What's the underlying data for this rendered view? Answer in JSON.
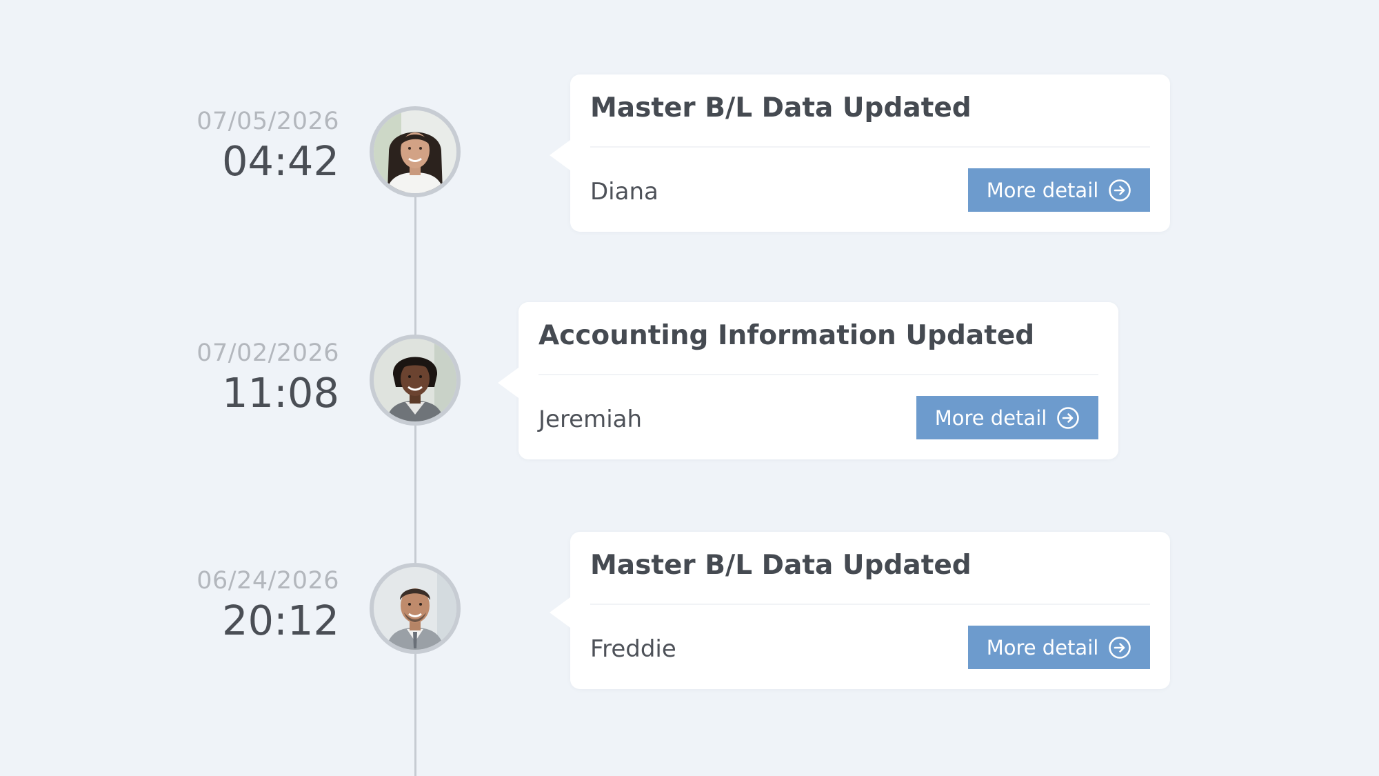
{
  "colors": {
    "background": "#eff3f8",
    "card": "#ffffff",
    "accent_button": "#6d9bcd",
    "timeline_line": "#c6cbd2",
    "date_text": "#b3b7bd",
    "time_text": "#4a4e55",
    "title_text": "#454a51"
  },
  "entries": [
    {
      "date": "07/05/2026",
      "time": "04:42",
      "title": "Master B/L Data Updated",
      "user": "Diana",
      "button_label": "More detail",
      "button_icon": "arrow-right-circle-icon",
      "avatar": "woman-portrait-avatar"
    },
    {
      "date": "07/02/2026",
      "time": "11:08",
      "title": "Accounting Information Updated",
      "user": "Jeremiah",
      "button_label": "More detail",
      "button_icon": "arrow-right-circle-icon",
      "avatar": "woman-portrait-avatar"
    },
    {
      "date": "06/24/2026",
      "time": "20:12",
      "title": "Master B/L Data Updated",
      "user": "Freddie",
      "button_label": "More detail",
      "button_icon": "arrow-right-circle-icon",
      "avatar": "man-portrait-avatar"
    }
  ]
}
